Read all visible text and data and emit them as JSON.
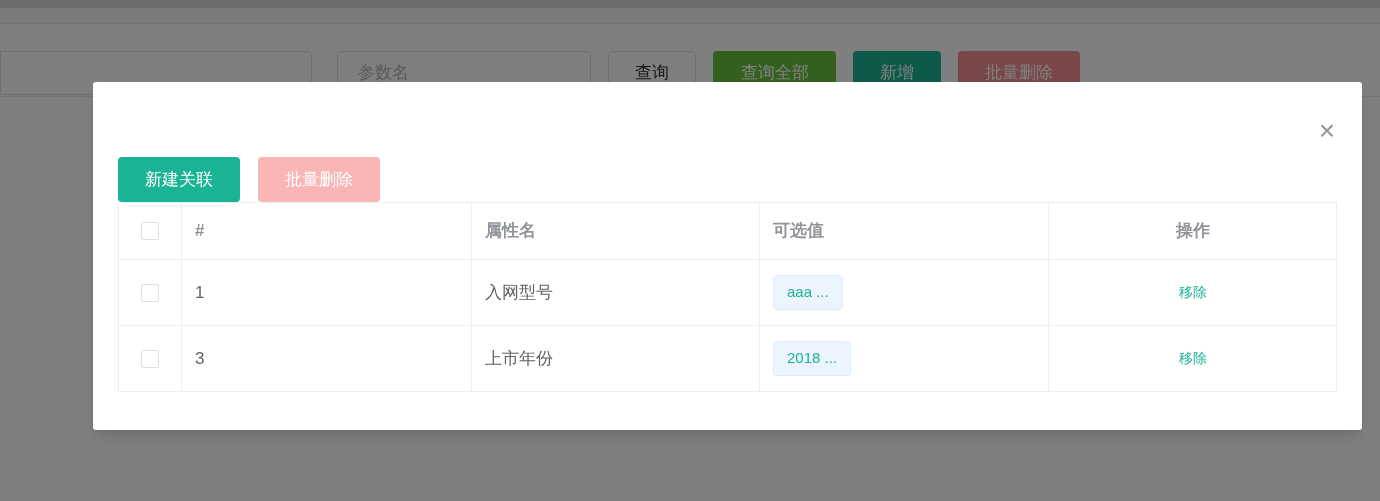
{
  "page": {
    "search": {
      "placeholder": "参数名"
    },
    "buttons": [
      {
        "label": "查询",
        "kind": "default",
        "disabled": false
      },
      {
        "label": "查询全部",
        "kind": "success",
        "disabled": false
      },
      {
        "label": "新增",
        "kind": "primary",
        "disabled": false
      },
      {
        "label": "批量删除",
        "kind": "danger",
        "disabled": true
      }
    ]
  },
  "dialog": {
    "close": "×",
    "buttons": [
      {
        "label": "新建关联",
        "kind": "primary",
        "disabled": false
      },
      {
        "label": "批量删除",
        "kind": "danger",
        "disabled": true
      }
    ],
    "table": {
      "columns": [
        "#",
        "属性名",
        "可选值",
        "操作"
      ],
      "select_all_checked": false,
      "rows": [
        {
          "checked": false,
          "index": "1",
          "name": "入网型号",
          "options": "aaa ...",
          "action": "移除"
        },
        {
          "checked": false,
          "index": "3",
          "name": "上市年份",
          "options": "2018 ...",
          "action": "移除"
        }
      ]
    }
  }
}
